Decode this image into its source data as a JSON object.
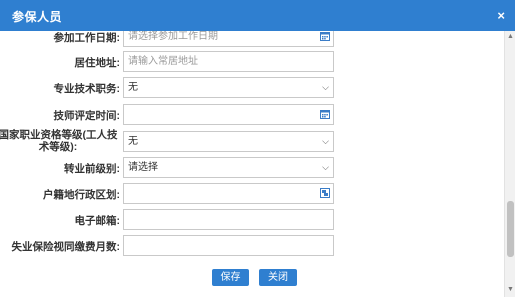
{
  "dialog": {
    "title": "参保人员",
    "close_glyph": "×"
  },
  "form": {
    "work_start_date": {
      "label": "参加工作日期:",
      "placeholder": "请选择参加工作日期"
    },
    "address": {
      "label": "居住地址:",
      "placeholder": "请输入常居地址"
    },
    "tech_position": {
      "label": "专业技术职务:",
      "value": "无"
    },
    "technician_eval_time": {
      "label": "技师评定时间:",
      "value": ""
    },
    "qualification_level": {
      "label": "国家职业资格等级(工人技术等级):",
      "value": "无"
    },
    "pre_transfer_level": {
      "label": "转业前级别:",
      "value": "请选择"
    },
    "household_region": {
      "label": "户籍地行政区划:",
      "value": ""
    },
    "email": {
      "label": "电子邮箱:",
      "value": ""
    },
    "unemployment_months": {
      "label": "失业保险视同缴费月数:",
      "value": ""
    }
  },
  "buttons": {
    "save": "保存",
    "close": "关闭"
  },
  "icons": {
    "calendar": "calendar-icon",
    "dropdown": "chevron-down-icon",
    "region_picker": "region-picker-icon",
    "close": "close-icon"
  },
  "colors": {
    "accent": "#2f7fd0",
    "icon_blue": "#3a7cc7"
  }
}
